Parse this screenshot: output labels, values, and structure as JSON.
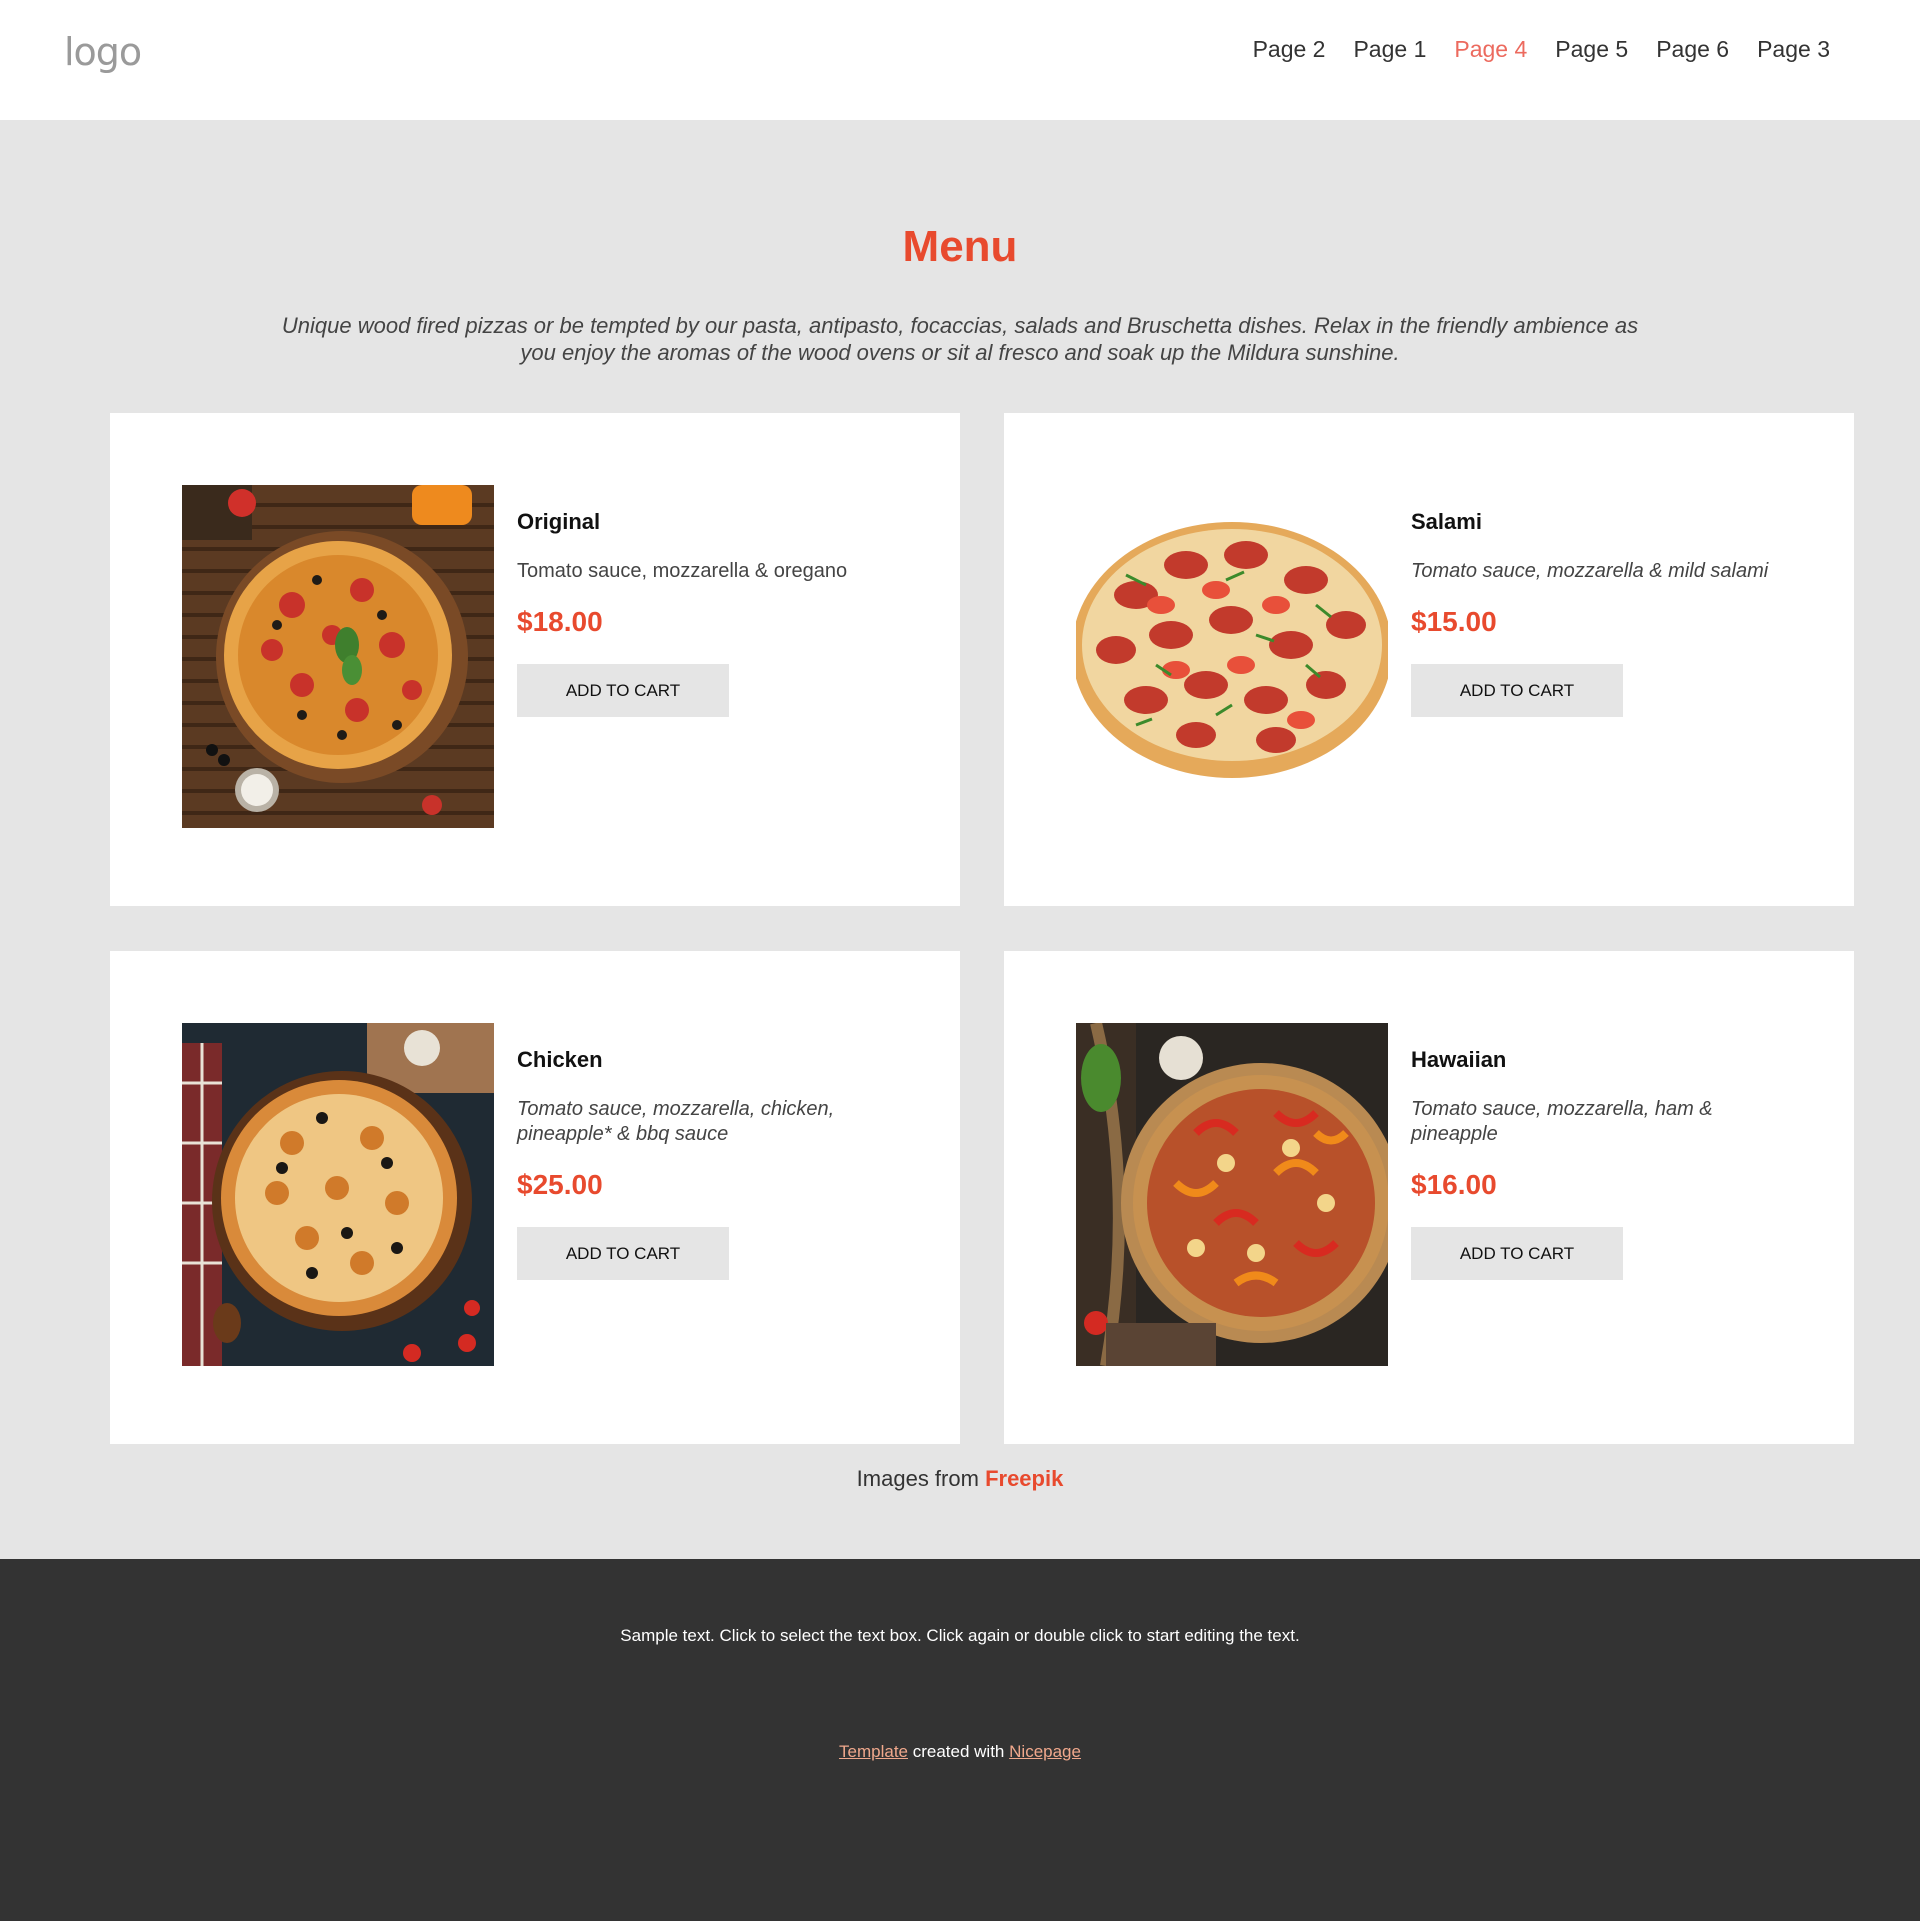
{
  "header": {
    "logo": "logo",
    "nav": [
      {
        "label": "Page 2",
        "active": false
      },
      {
        "label": "Page 1",
        "active": false
      },
      {
        "label": "Page 4",
        "active": true
      },
      {
        "label": "Page 5",
        "active": false
      },
      {
        "label": "Page 6",
        "active": false
      },
      {
        "label": "Page 3",
        "active": false
      }
    ]
  },
  "menu": {
    "title": "Menu",
    "intro": "Unique wood fired pizzas or be tempted by our pasta, antipasto, focaccias, salads and Bruschetta dishes. Relax in the friendly ambience as you enjoy the aromas of the wood ovens or sit al fresco and soak up the Mildura sunshine.",
    "items": [
      {
        "name": "Original",
        "description": "Tomato sauce, mozzarella & oregano",
        "price": "$18.00",
        "button": "ADD TO CART"
      },
      {
        "name": "Salami",
        "description": "Tomato sauce, mozzarella & mild salami",
        "price": "$15.00",
        "button": "ADD TO CART"
      },
      {
        "name": "Chicken",
        "description": "Tomato sauce, mozzarella, chicken, pineapple* & bbq sauce",
        "price": "$25.00",
        "button": "ADD TO CART"
      },
      {
        "name": "Hawaiian",
        "description": "Tomato sauce, mozzarella, ham & pineapple",
        "price": "$16.00",
        "button": "ADD TO CART"
      }
    ],
    "credit_prefix": "Images from",
    "credit_brand": "Freepik"
  },
  "footer": {
    "sample_text": "Sample text. Click to select the text box. Click again or double click to start editing the text.",
    "template_link": "Template",
    "created_with": "created with",
    "nicepage_link": "Nicepage"
  },
  "colors": {
    "accent": "#e84a2e",
    "nav_active": "#ec6a5e",
    "footer_bg": "#333333",
    "page_bg": "#e5e5e5"
  }
}
